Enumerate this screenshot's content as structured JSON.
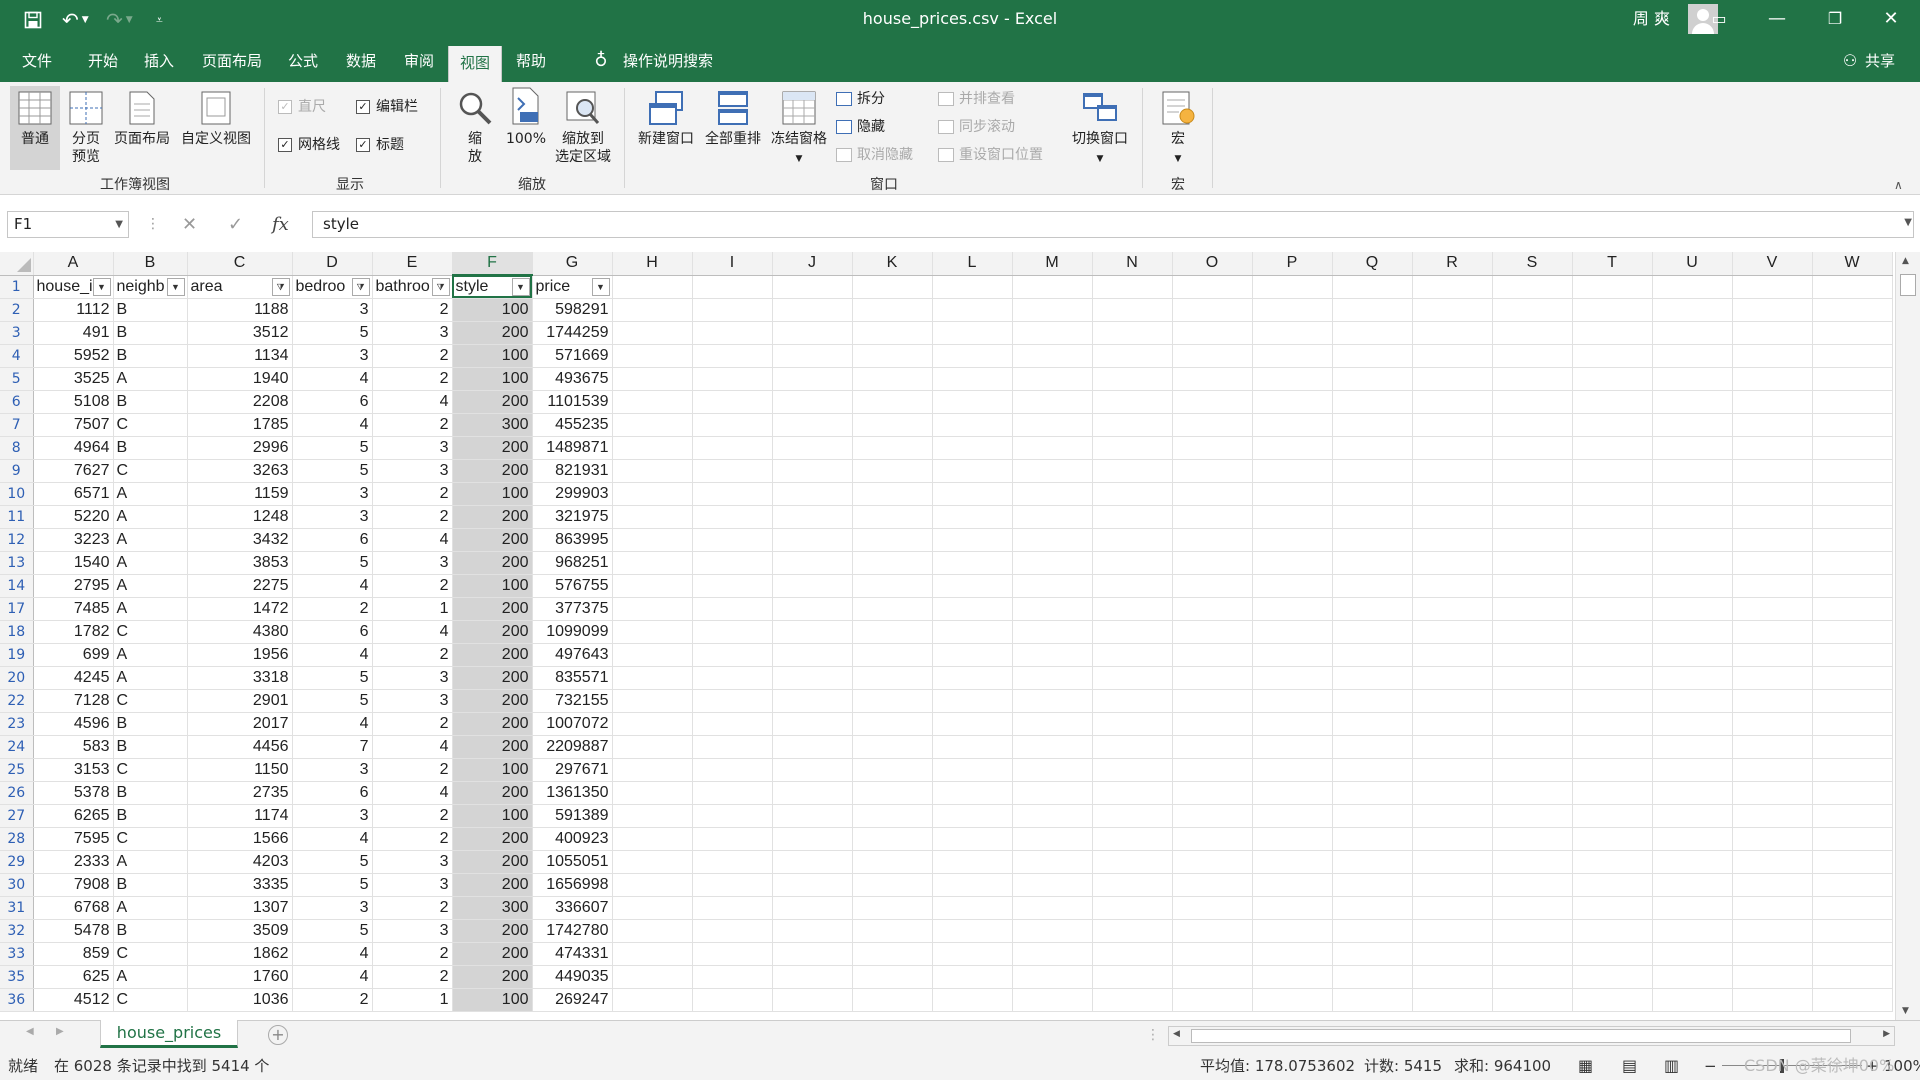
{
  "window": {
    "title": "house_prices.csv  -  Excel",
    "user": "周 爽",
    "share": "共享"
  },
  "menu": {
    "tabs": [
      "文件",
      "开始",
      "插入",
      "页面布局",
      "公式",
      "数据",
      "审阅",
      "视图",
      "帮助"
    ],
    "active": "视图",
    "search": "操作说明搜索"
  },
  "ribbon": {
    "workbook_views": {
      "label": "工作簿视图",
      "normal": "普通",
      "page_break_1": "分页",
      "page_break_2": "预览",
      "page_layout": "页面布局",
      "custom": "自定义视图"
    },
    "show": {
      "label": "显示",
      "ruler": "直尺",
      "formula_bar": "编辑栏",
      "gridlines": "网格线",
      "headings": "标题"
    },
    "zoom": {
      "label": "缩放",
      "zoom_1": "缩",
      "zoom_2": "放",
      "hundred": "100%",
      "to_sel_1": "缩放到",
      "to_sel_2": "选定区域"
    },
    "window": {
      "label": "窗口",
      "new_window": "新建窗口",
      "arrange_all": "全部重排",
      "freeze": "冻结窗格",
      "split": "拆分",
      "hide": "隐藏",
      "unhide": "取消隐藏",
      "side_by_side": "并排查看",
      "sync_scroll": "同步滚动",
      "reset_pos": "重设窗口位置",
      "switch": "切换窗口"
    },
    "macros": {
      "label": "宏",
      "macro": "宏"
    }
  },
  "formula_bar": {
    "name_box": "F1",
    "content": "style",
    "fx": "fx"
  },
  "sheet": {
    "columns": [
      "A",
      "B",
      "C",
      "D",
      "E",
      "F",
      "G",
      "H",
      "I",
      "J",
      "K",
      "L",
      "M",
      "N",
      "O",
      "P",
      "Q",
      "R",
      "S",
      "T",
      "U",
      "V",
      "W"
    ],
    "selected_column": "F",
    "headers": [
      "house_i",
      "neighb",
      "area",
      "bedroo",
      "bathroo",
      "style",
      "price"
    ],
    "rows": [
      {
        "r": "1"
      },
      {
        "r": "2",
        "v": [
          "1112",
          "B",
          "1188",
          "3",
          "2",
          "100",
          "598291"
        ]
      },
      {
        "r": "3",
        "v": [
          "491",
          "B",
          "3512",
          "5",
          "3",
          "200",
          "1744259"
        ]
      },
      {
        "r": "4",
        "v": [
          "5952",
          "B",
          "1134",
          "3",
          "2",
          "100",
          "571669"
        ]
      },
      {
        "r": "5",
        "v": [
          "3525",
          "A",
          "1940",
          "4",
          "2",
          "100",
          "493675"
        ]
      },
      {
        "r": "6",
        "v": [
          "5108",
          "B",
          "2208",
          "6",
          "4",
          "200",
          "1101539"
        ]
      },
      {
        "r": "7",
        "v": [
          "7507",
          "C",
          "1785",
          "4",
          "2",
          "300",
          "455235"
        ]
      },
      {
        "r": "8",
        "v": [
          "4964",
          "B",
          "2996",
          "5",
          "3",
          "200",
          "1489871"
        ]
      },
      {
        "r": "9",
        "v": [
          "7627",
          "C",
          "3263",
          "5",
          "3",
          "200",
          "821931"
        ]
      },
      {
        "r": "10",
        "v": [
          "6571",
          "A",
          "1159",
          "3",
          "2",
          "100",
          "299903"
        ]
      },
      {
        "r": "11",
        "v": [
          "5220",
          "A",
          "1248",
          "3",
          "2",
          "200",
          "321975"
        ]
      },
      {
        "r": "12",
        "v": [
          "3223",
          "A",
          "3432",
          "6",
          "4",
          "200",
          "863995"
        ]
      },
      {
        "r": "13",
        "v": [
          "1540",
          "A",
          "3853",
          "5",
          "3",
          "200",
          "968251"
        ]
      },
      {
        "r": "14",
        "v": [
          "2795",
          "A",
          "2275",
          "4",
          "2",
          "100",
          "576755"
        ]
      },
      {
        "r": "17",
        "v": [
          "7485",
          "A",
          "1472",
          "2",
          "1",
          "200",
          "377375"
        ]
      },
      {
        "r": "18",
        "v": [
          "1782",
          "C",
          "4380",
          "6",
          "4",
          "200",
          "1099099"
        ]
      },
      {
        "r": "19",
        "v": [
          "699",
          "A",
          "1956",
          "4",
          "2",
          "200",
          "497643"
        ]
      },
      {
        "r": "20",
        "v": [
          "4245",
          "A",
          "3318",
          "5",
          "3",
          "200",
          "835571"
        ]
      },
      {
        "r": "22",
        "v": [
          "7128",
          "C",
          "2901",
          "5",
          "3",
          "200",
          "732155"
        ]
      },
      {
        "r": "23",
        "v": [
          "4596",
          "B",
          "2017",
          "4",
          "2",
          "200",
          "1007072"
        ]
      },
      {
        "r": "24",
        "v": [
          "583",
          "B",
          "4456",
          "7",
          "4",
          "200",
          "2209887"
        ]
      },
      {
        "r": "25",
        "v": [
          "3153",
          "C",
          "1150",
          "3",
          "2",
          "100",
          "297671"
        ]
      },
      {
        "r": "26",
        "v": [
          "5378",
          "B",
          "2735",
          "6",
          "4",
          "200",
          "1361350"
        ]
      },
      {
        "r": "27",
        "v": [
          "6265",
          "B",
          "1174",
          "3",
          "2",
          "100",
          "591389"
        ]
      },
      {
        "r": "28",
        "v": [
          "7595",
          "C",
          "1566",
          "4",
          "2",
          "200",
          "400923"
        ]
      },
      {
        "r": "29",
        "v": [
          "2333",
          "A",
          "4203",
          "5",
          "3",
          "200",
          "1055051"
        ]
      },
      {
        "r": "30",
        "v": [
          "7908",
          "B",
          "3335",
          "5",
          "3",
          "200",
          "1656998"
        ]
      },
      {
        "r": "31",
        "v": [
          "6768",
          "A",
          "1307",
          "3",
          "2",
          "300",
          "336607"
        ]
      },
      {
        "r": "32",
        "v": [
          "5478",
          "B",
          "3509",
          "5",
          "3",
          "200",
          "1742780"
        ]
      },
      {
        "r": "33",
        "v": [
          "859",
          "C",
          "1862",
          "4",
          "2",
          "200",
          "474331"
        ]
      },
      {
        "r": "35",
        "v": [
          "625",
          "A",
          "1760",
          "4",
          "2",
          "200",
          "449035"
        ]
      },
      {
        "r": "36",
        "v": [
          "4512",
          "C",
          "1036",
          "2",
          "1",
          "100",
          "269247"
        ]
      }
    ]
  },
  "tabs": {
    "sheet": "house_prices"
  },
  "status": {
    "ready": "就绪",
    "filter": "在 6028 条记录中找到 5414 个",
    "average": "平均值: 178.0753602",
    "count": "计数: 5415",
    "sum": "求和: 964100",
    "zoom": "100%",
    "watermark": "CSDN @菜徐坤00%"
  },
  "colors": {
    "accent": "#217346"
  }
}
